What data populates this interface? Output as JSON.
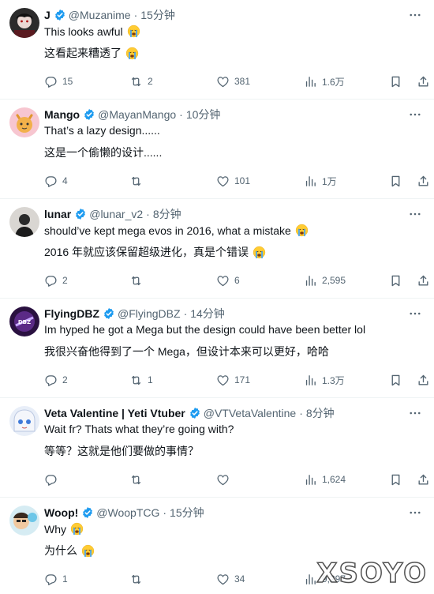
{
  "accent_color": "#1d9bf0",
  "tweets": [
    {
      "name": "J",
      "handle": "@Muzanime",
      "time": "15分钟",
      "en": "This looks awful",
      "zh": "这看起来糟透了",
      "en_emoji": "loudly-crying-emoji",
      "zh_emoji": "loudly-crying-emoji",
      "replies": "15",
      "reposts": "2",
      "likes": "381",
      "views": "1.6万"
    },
    {
      "name": "Mango",
      "handle": "@MayanMango",
      "time": "10分钟",
      "en": "That’s a lazy design......",
      "zh": "这是一个偷懒的设计......",
      "replies": "4",
      "reposts": "",
      "likes": "101",
      "views": "1万"
    },
    {
      "name": "lunar",
      "handle": "@lunar_v2",
      "time": "8分钟",
      "en": "should’ve kept mega evos in 2016, what a mistake",
      "zh": "2016 年就应该保留超级进化，真是个错误",
      "replies": "2",
      "reposts": "",
      "likes": "6",
      "views": "2,595"
    },
    {
      "name": "FlyingDBZ",
      "handle": "@FlyingDBZ",
      "time": "14分钟",
      "en": "Im hyped he got a Mega but the design could have been better lol",
      "zh": "我很兴奋他得到了一个 Mega，但设计本来可以更好，哈哈",
      "replies": "2",
      "reposts": "1",
      "likes": "171",
      "views": "1.3万"
    },
    {
      "name": "Veta Valentine | Yeti Vtuber",
      "handle": "@VTVetaValentine",
      "time": "8分钟",
      "en": "Wait fr? Thats what they’re going with?",
      "zh": "等等？这就是他们要做的事情？",
      "replies": "",
      "reposts": "",
      "likes": "",
      "views": "1,624"
    },
    {
      "name": "Woop!",
      "handle": "@WoopTCG",
      "time": "15分钟",
      "en": "Why",
      "zh": "为什么",
      "replies": "1",
      "reposts": "",
      "likes": "34",
      "views": "9,297"
    }
  ],
  "watermark": "XSOYO"
}
